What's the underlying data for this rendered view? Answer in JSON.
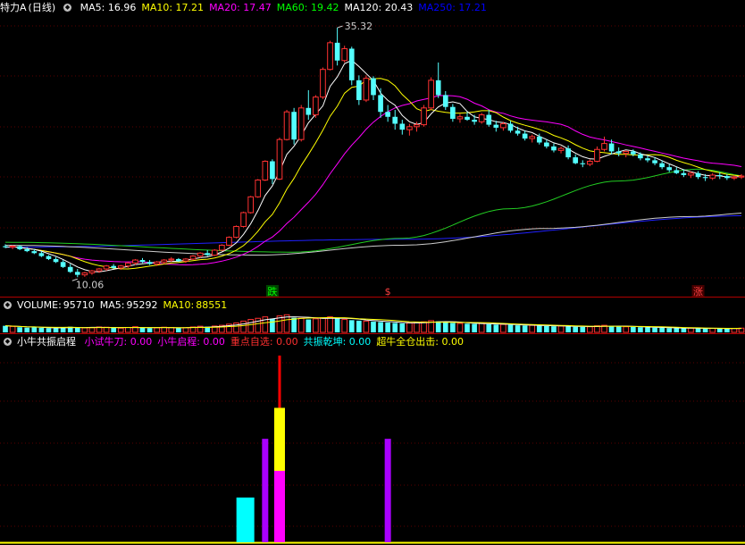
{
  "header": {
    "stock_name": "特力A",
    "period": "(日线)",
    "ma": [
      {
        "label": "MA5:",
        "value": "16.96",
        "color": "#ffffff"
      },
      {
        "label": "MA10:",
        "value": "17.21",
        "color": "#ffff00"
      },
      {
        "label": "MA20:",
        "value": "17.47",
        "color": "#ff00ff"
      },
      {
        "label": "MA60:",
        "value": "19.42",
        "color": "#00ff00"
      },
      {
        "label": "MA120:",
        "value": "20.43",
        "color": "#ffffff"
      },
      {
        "label": "MA250:",
        "value": "17.21",
        "color": "#0000ff"
      }
    ]
  },
  "price_annotations": {
    "high": "35.32",
    "low": "10.06",
    "marks": [
      {
        "text": "跌",
        "color": "#00ff00",
        "bg": "#004400"
      },
      {
        "text": "$",
        "color": "#ff4040",
        "bg": "#000000"
      },
      {
        "text": "涨",
        "color": "#ff4040",
        "bg": "#440000"
      }
    ]
  },
  "volume_header": {
    "label": "VOLUME:",
    "value": "95710",
    "ma5_label": "MA5:",
    "ma5_value": "95292",
    "ma10_label": "MA10:",
    "ma10_value": "88551"
  },
  "indicator_header": {
    "name": "小牛共振启程",
    "items": [
      {
        "label": "小试牛刀:",
        "value": "0.00",
        "color": "#ff00ff"
      },
      {
        "label": "小牛启程:",
        "value": "0.00",
        "color": "#ff00ff"
      },
      {
        "label": "重点自选:",
        "value": "0.00",
        "color": "#ff3030"
      },
      {
        "label": "共振乾坤:",
        "value": "0.00",
        "color": "#00ffff"
      },
      {
        "label": "超牛全仓出击:",
        "value": "0.00",
        "color": "#ffff00"
      }
    ]
  },
  "chart_data": {
    "type": "candlestick",
    "candles": [
      [
        13.2,
        13.4,
        13.0,
        13.1
      ],
      [
        13.1,
        13.3,
        12.9,
        13.2
      ],
      [
        13.2,
        13.3,
        12.8,
        12.9
      ],
      [
        12.9,
        13.1,
        12.6,
        12.7
      ],
      [
        12.7,
        12.9,
        12.4,
        12.5
      ],
      [
        12.5,
        12.7,
        12.1,
        12.2
      ],
      [
        12.2,
        12.3,
        11.8,
        11.9
      ],
      [
        11.9,
        12.1,
        11.5,
        11.6
      ],
      [
        11.6,
        11.8,
        11.0,
        11.1
      ],
      [
        11.1,
        11.4,
        10.5,
        10.6
      ],
      [
        10.6,
        10.9,
        10.06,
        10.3
      ],
      [
        10.3,
        10.6,
        10.1,
        10.5
      ],
      [
        10.5,
        10.8,
        10.3,
        10.7
      ],
      [
        10.7,
        11.0,
        10.5,
        10.9
      ],
      [
        10.9,
        11.3,
        10.7,
        11.2
      ],
      [
        11.2,
        11.4,
        10.9,
        11.0
      ],
      [
        11.0,
        11.3,
        10.8,
        11.2
      ],
      [
        11.2,
        11.6,
        11.0,
        11.5
      ],
      [
        11.5,
        11.9,
        11.3,
        11.8
      ],
      [
        11.8,
        12.0,
        11.5,
        11.6
      ],
      [
        11.6,
        11.8,
        11.3,
        11.4
      ],
      [
        11.4,
        11.7,
        11.2,
        11.6
      ],
      [
        11.6,
        11.9,
        11.4,
        11.8
      ],
      [
        11.8,
        12.1,
        11.6,
        11.9
      ],
      [
        11.9,
        12.0,
        11.6,
        11.7
      ],
      [
        11.7,
        12.0,
        11.5,
        11.9
      ],
      [
        11.9,
        12.3,
        11.8,
        12.2
      ],
      [
        12.2,
        12.6,
        12.0,
        12.5
      ],
      [
        12.5,
        12.8,
        12.2,
        12.3
      ],
      [
        12.3,
        12.9,
        12.2,
        12.8
      ],
      [
        12.8,
        13.4,
        12.7,
        13.3
      ],
      [
        13.3,
        14.2,
        13.2,
        14.1
      ],
      [
        14.1,
        15.3,
        14.0,
        15.2
      ],
      [
        15.2,
        16.7,
        15.1,
        16.6
      ],
      [
        16.6,
        18.3,
        16.5,
        18.2
      ],
      [
        18.2,
        20.0,
        18.1,
        19.9
      ],
      [
        19.9,
        21.9,
        19.8,
        21.8
      ],
      [
        21.8,
        22.0,
        19.5,
        20.0
      ],
      [
        20.0,
        24.2,
        19.9,
        24.0
      ],
      [
        24.0,
        27.0,
        23.9,
        26.8
      ],
      [
        26.8,
        27.2,
        23.5,
        24.0
      ],
      [
        24.0,
        27.5,
        23.8,
        27.2
      ],
      [
        27.2,
        29.0,
        26.0,
        26.5
      ],
      [
        26.5,
        28.5,
        26.2,
        28.3
      ],
      [
        28.3,
        31.3,
        28.1,
        31.1
      ],
      [
        31.1,
        34.0,
        31.0,
        33.8
      ],
      [
        33.8,
        35.32,
        31.5,
        32.0
      ],
      [
        32.0,
        33.5,
        31.8,
        33.2
      ],
      [
        33.2,
        33.4,
        29.5,
        30.0
      ],
      [
        30.0,
        30.5,
        27.5,
        28.0
      ],
      [
        28.0,
        30.5,
        27.8,
        30.2
      ],
      [
        30.2,
        30.4,
        28.0,
        28.5
      ],
      [
        28.5,
        29.2,
        26.2,
        26.8
      ],
      [
        26.8,
        27.5,
        25.8,
        26.3
      ],
      [
        26.3,
        27.0,
        25.0,
        25.6
      ],
      [
        25.6,
        26.0,
        24.5,
        25.0
      ],
      [
        25.0,
        25.6,
        24.4,
        25.3
      ],
      [
        25.3,
        25.8,
        24.8,
        25.5
      ],
      [
        25.5,
        27.5,
        25.3,
        27.2
      ],
      [
        27.2,
        30.3,
        27.0,
        30.0
      ],
      [
        30.0,
        31.8,
        28.2,
        28.5
      ],
      [
        28.5,
        28.9,
        27.0,
        27.3
      ],
      [
        27.3,
        27.6,
        25.8,
        26.1
      ],
      [
        26.1,
        26.6,
        25.7,
        26.3
      ],
      [
        26.3,
        26.8,
        25.9,
        26.0
      ],
      [
        26.0,
        26.5,
        25.5,
        25.8
      ],
      [
        25.8,
        26.7,
        25.6,
        26.5
      ],
      [
        26.5,
        27.0,
        25.3,
        25.5
      ],
      [
        25.5,
        25.9,
        24.8,
        25.2
      ],
      [
        25.2,
        25.8,
        24.9,
        25.6
      ],
      [
        25.6,
        25.9,
        24.7,
        24.9
      ],
      [
        24.9,
        25.3,
        24.4,
        24.6
      ],
      [
        24.6,
        24.9,
        23.9,
        24.1
      ],
      [
        24.1,
        24.5,
        23.7,
        24.3
      ],
      [
        24.3,
        24.6,
        23.5,
        23.7
      ],
      [
        23.7,
        24.0,
        23.1,
        23.3
      ],
      [
        23.3,
        23.6,
        22.7,
        22.9
      ],
      [
        22.9,
        23.3,
        22.6,
        23.1
      ],
      [
        23.1,
        23.4,
        22.0,
        22.2
      ],
      [
        22.2,
        22.5,
        21.5,
        21.6
      ],
      [
        21.6,
        21.9,
        21.2,
        21.5
      ],
      [
        21.5,
        22.0,
        21.3,
        21.8
      ],
      [
        21.8,
        23.3,
        21.7,
        23.0
      ],
      [
        23.0,
        24.3,
        22.8,
        23.6
      ],
      [
        23.6,
        24.0,
        22.5,
        22.8
      ],
      [
        22.8,
        23.2,
        22.3,
        22.6
      ],
      [
        22.6,
        22.9,
        22.2,
        22.8
      ],
      [
        22.8,
        23.0,
        22.3,
        22.5
      ],
      [
        22.5,
        22.7,
        21.9,
        22.1
      ],
      [
        22.1,
        22.4,
        21.7,
        21.9
      ],
      [
        21.9,
        22.2,
        21.4,
        21.6
      ],
      [
        21.6,
        21.9,
        21.0,
        21.2
      ],
      [
        21.2,
        21.5,
        20.7,
        20.9
      ],
      [
        20.9,
        21.2,
        20.5,
        20.6
      ],
      [
        20.6,
        21.0,
        20.2,
        20.4
      ],
      [
        20.4,
        20.8,
        20.1,
        20.6
      ],
      [
        20.6,
        20.8,
        20.0,
        20.2
      ],
      [
        20.2,
        20.5,
        19.8,
        20.1
      ],
      [
        20.1,
        20.6,
        19.9,
        20.4
      ],
      [
        20.4,
        20.7,
        20.0,
        20.3
      ],
      [
        20.3,
        20.5,
        19.9,
        20.1
      ],
      [
        20.1,
        20.4,
        19.9,
        20.2
      ],
      [
        20.2,
        20.5,
        20.0,
        20.3
      ]
    ],
    "volume": [
      28,
      25,
      22,
      20,
      21,
      19,
      18,
      17,
      22,
      24,
      21,
      19,
      20,
      23,
      22,
      19,
      18,
      21,
      24,
      20,
      18,
      19,
      22,
      21,
      18,
      20,
      23,
      26,
      24,
      27,
      30,
      35,
      40,
      48,
      55,
      60,
      66,
      58,
      70,
      75,
      62,
      60,
      55,
      58,
      62,
      66,
      60,
      55,
      52,
      50,
      48,
      46,
      44,
      42,
      40,
      38,
      40,
      42,
      45,
      50,
      47,
      44,
      40,
      38,
      37,
      36,
      38,
      35,
      33,
      34,
      32,
      30,
      29,
      30,
      28,
      27,
      26,
      27,
      25,
      24,
      23,
      24,
      28,
      30,
      27,
      25,
      24,
      23,
      22,
      21,
      20,
      19,
      18,
      18,
      17,
      18,
      17,
      16,
      17,
      16,
      16,
      17,
      18
    ],
    "indicator_bars": [
      {
        "candle": 34,
        "color": "#00ffff",
        "value": 0.42
      },
      {
        "candle": 36,
        "color": "#aa00ff",
        "value": 0.97
      },
      {
        "candle": 38,
        "color": "#ff00ff",
        "value": 0.67
      },
      {
        "candle": 38,
        "color": "#ffff00",
        "value": 1.26
      },
      {
        "candle": 38,
        "color": "#ff0000",
        "value": 1.75
      },
      {
        "candle": 53,
        "color": "#aa00ff",
        "value": 0.97
      }
    ],
    "indicator_ylim": [
      0,
      1.8
    ],
    "price_ylim": [
      9.0,
      36.5
    ],
    "volume_ylim": [
      0,
      80
    ],
    "ma60_curve": [
      [
        0,
        13.6
      ],
      [
        40,
        12.6
      ],
      [
        55,
        14.0
      ],
      [
        70,
        17.0
      ],
      [
        85,
        19.8
      ],
      [
        96,
        21.0
      ],
      [
        104,
        20.2
      ]
    ],
    "ma120_curve": [
      [
        0,
        13.3
      ],
      [
        35,
        12.3
      ],
      [
        55,
        13.3
      ],
      [
        75,
        15.0
      ],
      [
        95,
        16.2
      ],
      [
        104,
        16.6
      ]
    ],
    "ma250_curve": [
      [
        0,
        13.1
      ],
      [
        55,
        13.9
      ],
      [
        104,
        16.3
      ]
    ],
    "mark_candles": [
      [
        37,
        "跌"
      ],
      [
        53,
        "$"
      ],
      [
        96,
        "涨"
      ]
    ],
    "high_candle": 46,
    "low_candle": 10
  }
}
